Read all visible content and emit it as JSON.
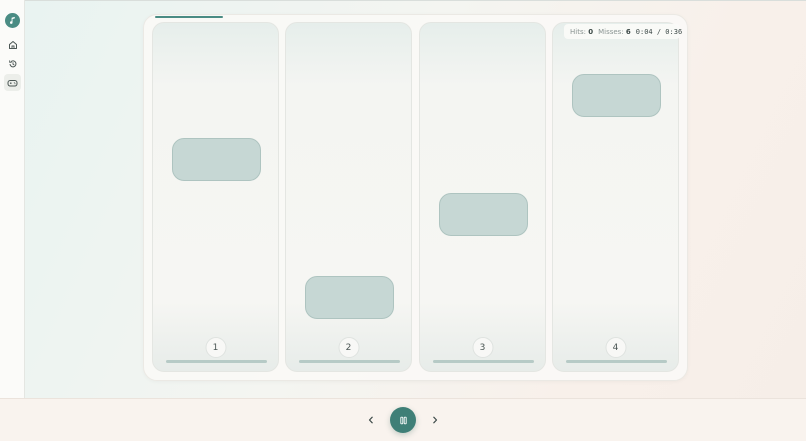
{
  "stats": {
    "hits_label": "Hits:",
    "hits_value": "0",
    "misses_label": "Misses:",
    "misses_value": "6",
    "elapsed": "0:04",
    "separator": "/",
    "duration": "0:36"
  },
  "progress": 0.13,
  "lanes": [
    {
      "label": "1"
    },
    {
      "label": "2"
    },
    {
      "label": "3"
    },
    {
      "label": "4"
    }
  ],
  "icons": {
    "logo": "music-note-icon",
    "nav_home": "home-icon",
    "nav_history": "history-icon",
    "nav_games": "gamepad-icon",
    "prev": "chevron-left-icon",
    "play": "pause-icon",
    "next": "chevron-right-icon"
  },
  "colors": {
    "accent": "#4a8c84",
    "tile": "#c6d7d4"
  }
}
